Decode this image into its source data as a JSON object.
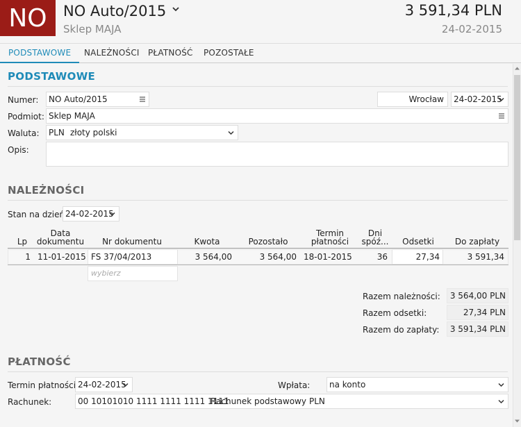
{
  "header": {
    "badge": "NO",
    "title": "NO Auto/2015",
    "subtitle": "Sklep MAJA",
    "amount": "3 591,34 PLN",
    "date": "24-02-2015"
  },
  "tabs": [
    {
      "label": "PODSTAWOWE",
      "active": true
    },
    {
      "label": "NALEŻNOŚCI",
      "active": false
    },
    {
      "label": "PŁATNOŚĆ",
      "active": false
    },
    {
      "label": "POZOSTAŁE",
      "active": false
    }
  ],
  "podstawowe": {
    "title": "PODSTAWOWE",
    "numer_label": "Numer:",
    "numer_value": "NO Auto/2015",
    "place_value": "Wrocław",
    "date_value": "24-02-2015",
    "podmiot_label": "Podmiot:",
    "podmiot_value": "Sklep MAJA",
    "waluta_label": "Waluta:",
    "waluta_code": "PLN",
    "waluta_name": "złoty polski",
    "opis_label": "Opis:",
    "opis_value": ""
  },
  "naleznosci": {
    "title": "NALEŻNOŚCI",
    "stan_label": "Stan na dzień:",
    "stan_value": "24-02-2015",
    "columns": {
      "lp": "Lp",
      "data_1": "Data",
      "data_2": "dokumentu",
      "nr": "Nr dokumentu",
      "kwota": "Kwota",
      "pozostalo": "Pozostało",
      "termin_1": "Termin",
      "termin_2": "płatności",
      "dni_1": "Dni",
      "dni_2": "spóź...",
      "odsetki": "Odsetki",
      "do_zaplaty": "Do zapłaty"
    },
    "rows": [
      {
        "lp": "1",
        "data": "11-01-2015",
        "nr": "FS 37/04/2013",
        "kwota": "3 564,00",
        "pozostalo": "3 564,00",
        "termin": "18-01-2015",
        "dni": "36",
        "odsetki": "27,34",
        "do_zaplaty": "3 591,34"
      }
    ],
    "new_row_placeholder": "wybierz",
    "totals": {
      "razem_naleznosci_label": "Razem należności:",
      "razem_naleznosci_value": "3 564,00 PLN",
      "razem_odsetki_label": "Razem odsetki:",
      "razem_odsetki_value": "27,34 PLN",
      "razem_do_zaplaty_label": "Razem do zapłaty:",
      "razem_do_zaplaty_value": "3 591,34 PLN"
    }
  },
  "platnosc": {
    "title": "PŁATNOŚĆ",
    "termin_label": "Termin płatności:",
    "termin_value": "24-02-2015",
    "wplata_label": "Wpłata:",
    "wplata_value": "na konto",
    "rachunek_label": "Rachunek:",
    "rachunek_number": "00 10101010 1111 1111 1111 1111",
    "rachunek_name": "Rachunek podstawowy",
    "rachunek_currency": "PLN"
  },
  "icons": {
    "menu": "hamburger-icon",
    "dropdown": "chevron-down-icon"
  },
  "colors": {
    "badge_bg": "#9b1c17",
    "accent": "#1f8bb8"
  }
}
